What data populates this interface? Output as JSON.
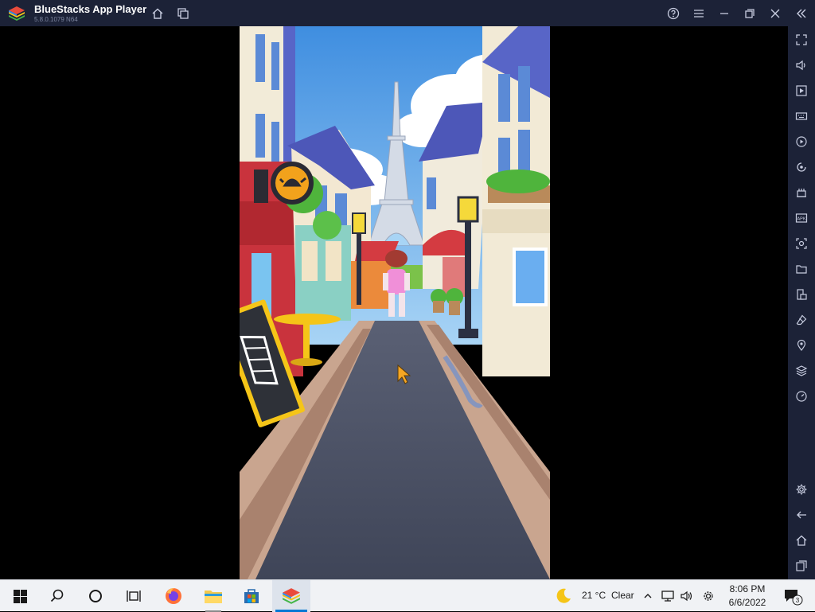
{
  "window": {
    "title": "BlueStacks App Player",
    "version": "5.8.0.1079  N64",
    "icons": [
      "bluestacks-logo",
      "home-icon",
      "multi-instance-icon",
      "help-icon",
      "menu-icon",
      "minimize-icon",
      "restore-icon",
      "close-icon",
      "collapse-sidebar-icon"
    ]
  },
  "sidebar": {
    "items": [
      "fullscreen-icon",
      "volume-icon",
      "media-icon",
      "keyboard-icon",
      "record-icon",
      "rotate-icon",
      "macro-icon",
      "apk-icon",
      "screenshot-icon",
      "folder-icon",
      "multi-window-icon",
      "erase-icon",
      "location-icon",
      "stack-icon",
      "performance-icon",
      "settings-icon",
      "back-icon",
      "home-icon",
      "recent-apps-icon"
    ]
  },
  "game": {
    "scene": "city-street-runner",
    "colors": {
      "sky": "#5aa2e6",
      "road": "#4b5266",
      "sidewalk": "#c9a58f"
    }
  },
  "taskbar": {
    "apps": [
      "start-icon",
      "search-icon",
      "cortana-icon",
      "task-view-icon",
      "firefox-icon",
      "file-explorer-icon",
      "store-icon",
      "bluestacks-icon"
    ],
    "weather": {
      "temp": "21 °C",
      "condition": "Clear"
    },
    "clock": {
      "time": "8:06 PM",
      "date": "6/6/2022"
    },
    "notifications": "3"
  }
}
